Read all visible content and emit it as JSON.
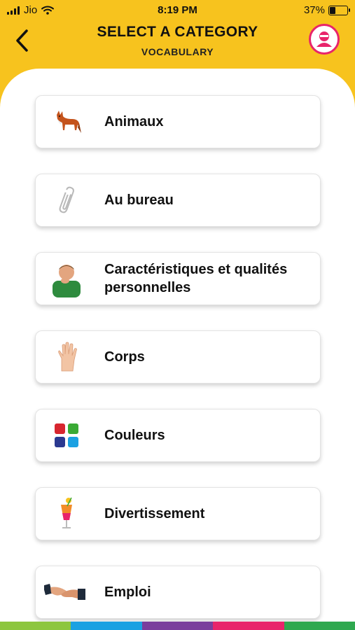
{
  "status_bar": {
    "carrier": "Jio",
    "time": "8:19 PM",
    "battery": "37%"
  },
  "header": {
    "title": "SELECT A CATEGORY",
    "subtitle": "VOCABULARY"
  },
  "categories": [
    {
      "label": "Animaux",
      "icon": "fox-icon"
    },
    {
      "label": "Au bureau",
      "icon": "paperclip-icon"
    },
    {
      "label": "Caractéristiques et qualités personnelles",
      "icon": "thinking-man-icon"
    },
    {
      "label": "Corps",
      "icon": "hand-icon"
    },
    {
      "label": "Couleurs",
      "icon": "color-squares-icon"
    },
    {
      "label": "Divertissement",
      "icon": "cocktail-icon"
    },
    {
      "label": "Emploi",
      "icon": "handshake-icon"
    }
  ],
  "colors": {
    "header_bg": "#F7C31E",
    "profile_accent": "#E8246B",
    "bottom_strip": [
      "#8DC63F",
      "#1BA1E2",
      "#7A3E9D",
      "#E8246B",
      "#2FA84F"
    ]
  }
}
